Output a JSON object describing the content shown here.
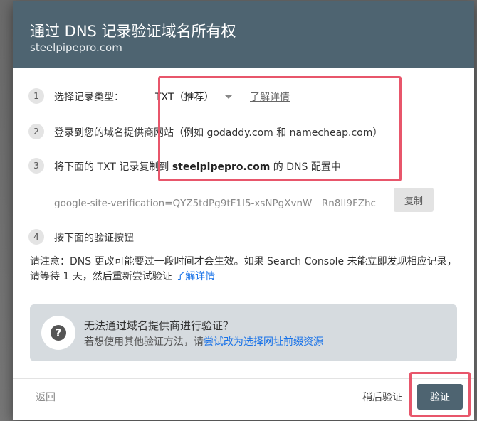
{
  "dialog": {
    "title": "通过 DNS 记录验证域名所有权",
    "domain": "steelpipepro.com"
  },
  "steps": [
    {
      "number": "1",
      "label": "选择记录类型：",
      "record_type": "TXT（推荐）",
      "learn_more": "了解详情"
    },
    {
      "number": "2",
      "label": "登录到您的域名提供商网站（例如 godaddy.com 和 namecheap.com）"
    },
    {
      "number": "3",
      "prefix": "将下面的 TXT 记录复制到 ",
      "domain": "steelpipepro.com",
      "suffix": " 的 DNS 配置中"
    },
    {
      "number": "4",
      "label": "按下面的验证按钮"
    }
  ],
  "record": {
    "value": "google-site-verification=QYZ5tdPg9tF1I5-xsNPgXvnW__Rn8II9FZhc",
    "copy_label": "复制"
  },
  "notice": {
    "text": "请注意：DNS 更改可能要过一段时间才会生效。如果 Search Console 未能立即发现相应记录，请等待 1 天，然后重新尝试验证 ",
    "link": "了解详情"
  },
  "alternative": {
    "title": "无法通过域名提供商进行验证？",
    "desc_prefix": "若想使用其他验证方法，请",
    "link": "尝试改为选择网址前缀资源"
  },
  "footer": {
    "back_label": "返回",
    "later_label": "稍后验证",
    "verify_label": "验证"
  },
  "colors": {
    "header_bg": "#4e6471",
    "highlight": "#e8566b",
    "link": "#1a73e8"
  }
}
